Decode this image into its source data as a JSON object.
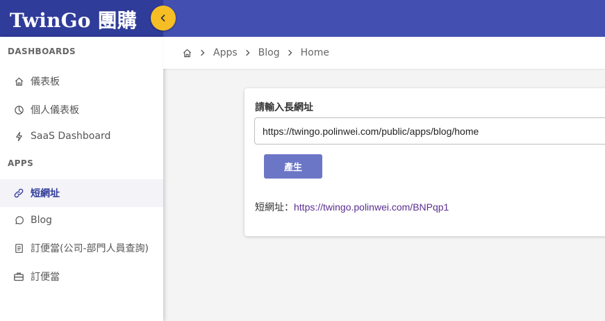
{
  "brand": {
    "title": "TwinGo 團購"
  },
  "colors": {
    "topbar": "#4350b2",
    "brand_bg": "#303c99",
    "collapse_button": "#f6be24",
    "primary_button": "#6c76c6",
    "active_nav_text": "#303c99",
    "link": "#5a2d91"
  },
  "sidebar": {
    "sections": [
      {
        "title": "DASHBOARDS",
        "items": [
          {
            "label": "儀表板",
            "icon": "home-icon"
          },
          {
            "label": "個人儀表板",
            "icon": "pie-chart-icon"
          },
          {
            "label": "SaaS Dashboard",
            "icon": "lightning-icon"
          }
        ]
      },
      {
        "title": "APPS",
        "items": [
          {
            "label": "短網址",
            "icon": "link-icon",
            "active": true
          },
          {
            "label": "Blog",
            "icon": "chat-bubble-icon"
          },
          {
            "label": "訂便當(公司-部門人員查詢)",
            "icon": "document-icon"
          },
          {
            "label": "訂便當",
            "icon": "briefcase-icon"
          }
        ]
      }
    ]
  },
  "breadcrumb": {
    "home_icon": "home-icon",
    "items": [
      "Apps",
      "Blog",
      "Home"
    ]
  },
  "form": {
    "label": "請輸入長網址",
    "input_value": "https://twingo.polinwei.com/public/apps/blog/home",
    "button_label": "產生",
    "result_label": "短網址：",
    "result_url": "https://twingo.polinwei.com/BNPqp1"
  }
}
